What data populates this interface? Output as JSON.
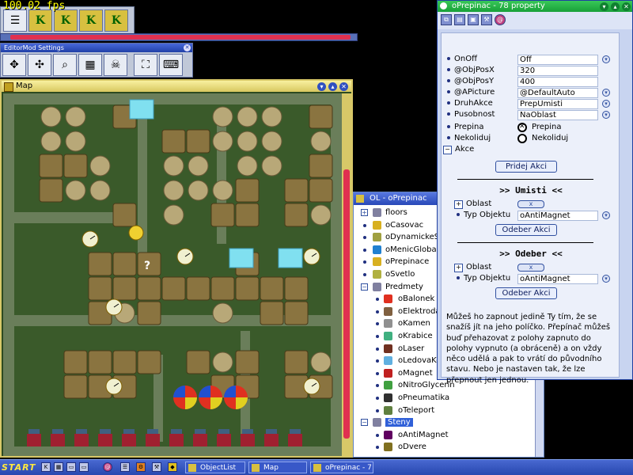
{
  "fps": "100.02 fps",
  "editor_mod": {
    "title": "EditorMod Settings"
  },
  "map_window": {
    "title": "Map",
    "cursor_label": "?"
  },
  "object_list": {
    "title": "OL - oPrepinac",
    "items": [
      {
        "label": "floors",
        "group": true,
        "expanded": false,
        "child": false,
        "color": "#8080a0"
      },
      {
        "label": "oCasovac",
        "group": false,
        "child": false,
        "color": "#d8b020"
      },
      {
        "label": "oDynamickeSvetlo",
        "group": false,
        "child": false,
        "color": "#a0a040"
      },
      {
        "label": "oMenicGlobalnich",
        "group": false,
        "child": false,
        "color": "#2080d0"
      },
      {
        "label": "oPrepinace",
        "group": false,
        "child": false,
        "color": "#d8b020"
      },
      {
        "label": "oSvetlo",
        "group": false,
        "child": false,
        "color": "#b0b040"
      },
      {
        "label": "Predmety",
        "group": true,
        "expanded": true,
        "child": false,
        "color": "#8080a0"
      },
      {
        "label": "oBalonek",
        "group": false,
        "child": true,
        "color": "#e03020"
      },
      {
        "label": "oElektroda",
        "group": false,
        "child": true,
        "color": "#806040"
      },
      {
        "label": "oKamen",
        "group": false,
        "child": true,
        "color": "#909090"
      },
      {
        "label": "oKrabice",
        "group": false,
        "child": true,
        "color": "#40b080"
      },
      {
        "label": "oLaser",
        "group": false,
        "child": true,
        "color": "#703020"
      },
      {
        "label": "oLedovaKostka",
        "group": false,
        "child": true,
        "color": "#60b0e0"
      },
      {
        "label": "oMagnet",
        "group": false,
        "child": true,
        "color": "#c02020"
      },
      {
        "label": "oNitroGlycerin",
        "group": false,
        "child": true,
        "color": "#40a040"
      },
      {
        "label": "oPneumatika",
        "group": false,
        "child": true,
        "color": "#303030"
      },
      {
        "label": "oTeleport",
        "group": false,
        "child": true,
        "color": "#608040"
      },
      {
        "label": "Steny",
        "group": true,
        "expanded": true,
        "child": false,
        "selected": true,
        "color": "#8080a0"
      },
      {
        "label": "oAntiMagnet",
        "group": false,
        "child": true,
        "color": "#600060"
      },
      {
        "label": "oDvere",
        "group": false,
        "child": true,
        "color": "#807020"
      }
    ]
  },
  "property_window": {
    "title": "oPrepinac - 78 property",
    "rows": [
      {
        "label": "OnOff",
        "value": "Off",
        "dropdown": true
      },
      {
        "label": "@ObjPosX",
        "value": "320",
        "dropdown": false
      },
      {
        "label": "@ObjPosY",
        "value": "400",
        "dropdown": false
      },
      {
        "label": "@APicture",
        "value": "@DefaultAuto",
        "dropdown": true
      },
      {
        "label": "DruhAkce",
        "value": "PrepUmisti",
        "dropdown": true
      },
      {
        "label": "Pusobnost",
        "value": "NaOblast",
        "dropdown": true
      }
    ],
    "prepina": {
      "label": "Prepina",
      "option": "Prepina"
    },
    "nekoliduj": {
      "label": "Nekoliduj",
      "option": "Nekoliduj"
    },
    "akce_label": "Akce",
    "pridej_akci": "Pridej Akci",
    "umisti": {
      "heading": ">> Umisti <<",
      "oblast": "Oblast",
      "typ_label": "Typ Objektu",
      "typ_value": "oAntiMagnet",
      "button": "Odeber Akci"
    },
    "odeber": {
      "heading": ">> Odeber <<",
      "oblast": "Oblast",
      "typ_label": "Typ Objektu",
      "typ_value": "oAntiMagnet",
      "button": "Odeber Akci"
    },
    "x_label": "x",
    "description": "Můžeš ho zapnout jedině Ty tím, že se snažíš jít na jeho políčko. Přepínač můžeš buď přehazovat z polohy zapnuto do polohy vypnuto (a obráceně) a on vždy něco udělá a pak to vrátí do původního stavu. Nebo je nastaven tak, že lze přepnout jen jednou."
  },
  "taskbar": {
    "start": "START",
    "tasks": [
      {
        "label": "ObjectList"
      },
      {
        "label": "Map"
      },
      {
        "label": "oPrepinac - 7"
      }
    ]
  },
  "colors": {
    "map_bg": "#3a5a2a",
    "floor": "#4c7038",
    "wall": "#6a7e5a",
    "crate": "#8a7440",
    "stone": "#b8a878"
  }
}
